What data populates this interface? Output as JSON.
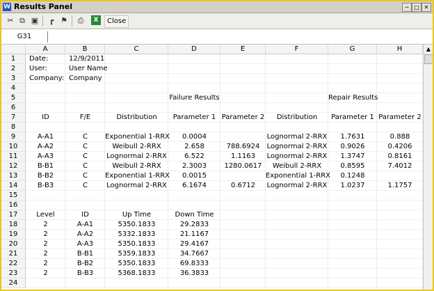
{
  "window": {
    "title": "Results Panel",
    "app_icon": "W"
  },
  "toolbar": {
    "close_label": "Close",
    "excel_icon_glyph": "X"
  },
  "formula_bar": {
    "cell_ref": "G31",
    "value": ""
  },
  "columns": [
    "A",
    "B",
    "C",
    "D",
    "E",
    "F",
    "G",
    "H"
  ],
  "rows": [
    "1",
    "2",
    "3",
    "4",
    "5",
    "6",
    "7",
    "8",
    "9",
    "10",
    "11",
    "12",
    "13",
    "14",
    "15",
    "16",
    "17",
    "18",
    "19",
    "20",
    "21",
    "22",
    "23",
    "24"
  ],
  "cells": {
    "r1": {
      "a": "Date:",
      "b": "12/9/2011"
    },
    "r2": {
      "a": "User:",
      "b": "User Name"
    },
    "r3": {
      "a": "Company:",
      "b": "Company"
    },
    "r5": {
      "d": "Failure Results",
      "g": "Repair Results"
    },
    "r7": {
      "a": "ID",
      "b": "F/E",
      "c": "Distribution",
      "d": "Parameter 1",
      "e": "Parameter 2",
      "f": "Distribution",
      "g": "Parameter 1",
      "h": "Parameter 2"
    },
    "r9": {
      "a": "A-A1",
      "b": "C",
      "c": "Exponential 1-RRX",
      "d": "0.0004",
      "e": "",
      "f": "Lognormal 2-RRX",
      "g": "1.7631",
      "h": "0.888"
    },
    "r10": {
      "a": "A-A2",
      "b": "C",
      "c": "Weibull 2-RRX",
      "d": "2.658",
      "e": "788.6924",
      "f": "Lognormal 2-RRX",
      "g": "0.9026",
      "h": "0.4206"
    },
    "r11": {
      "a": "A-A3",
      "b": "C",
      "c": "Lognormal 2-RRX",
      "d": "6.522",
      "e": "1.1163",
      "f": "Lognormal 2-RRX",
      "g": "1.3747",
      "h": "0.8161"
    },
    "r12": {
      "a": "B-B1",
      "b": "C",
      "c": "Weibull 2-RRX",
      "d": "2.3003",
      "e": "1280.0617",
      "f": "Weibull 2-RRX",
      "g": "0.8595",
      "h": "7.4012"
    },
    "r13": {
      "a": "B-B2",
      "b": "C",
      "c": "Exponential 1-RRX",
      "d": "0.0015",
      "e": "",
      "f": "Exponential 1-RRX",
      "g": "0.1248",
      "h": ""
    },
    "r14": {
      "a": "B-B3",
      "b": "C",
      "c": "Lognormal 2-RRX",
      "d": "6.1674",
      "e": "0.6712",
      "f": "Lognormal 2-RRX",
      "g": "1.0237",
      "h": "1.1757"
    },
    "r17": {
      "a": "Level",
      "b": "ID",
      "c": "Up Time",
      "d": "Down Time"
    },
    "r18": {
      "a": "2",
      "b": "A-A1",
      "c": "5350.1833",
      "d": "29.2833"
    },
    "r19": {
      "a": "2",
      "b": "A-A2",
      "c": "5332.1833",
      "d": "21.1167"
    },
    "r20": {
      "a": "2",
      "b": "A-A3",
      "c": "5350.1833",
      "d": "29.4167"
    },
    "r21": {
      "a": "2",
      "b": "B-B1",
      "c": "5359.1833",
      "d": "34.7667"
    },
    "r22": {
      "a": "2",
      "b": "B-B2",
      "c": "5350.1833",
      "d": "69.8333"
    },
    "r23": {
      "a": "2",
      "b": "B-B3",
      "c": "5368.1833",
      "d": "36.3833"
    }
  }
}
